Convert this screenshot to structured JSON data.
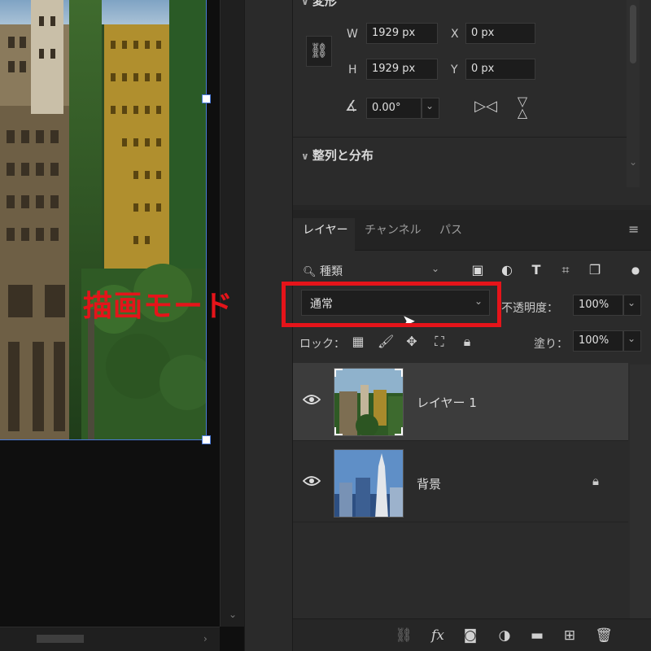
{
  "properties": {
    "section_transform": "変形",
    "w_label": "W",
    "w_value": "1929 px",
    "h_label": "H",
    "h_value": "1929 px",
    "x_label": "X",
    "x_value": "0 px",
    "y_label": "Y",
    "y_value": "0 px",
    "angle_value": "0.00°",
    "section_align": "整列と分布",
    "icons": [
      "link-icon",
      "angle-icon",
      "flip-horizontal-icon",
      "flip-vertical-icon",
      "chevron-down-icon"
    ]
  },
  "layers_panel": {
    "tabs": [
      {
        "label": "レイヤー",
        "active": true
      },
      {
        "label": "チャンネル",
        "active": false
      },
      {
        "label": "パス",
        "active": false
      }
    ],
    "filter_label": "種類",
    "filter_icons": [
      "image-filter-icon",
      "adjustment-filter-icon",
      "type-filter-icon",
      "shape-filter-icon",
      "smart-object-filter-icon",
      "filter-toggle-icon"
    ],
    "blend_mode": "通常",
    "opacity_label": "不透明度：",
    "opacity_value": "100%",
    "lock_label": "ロック：",
    "fill_label": "塗り：",
    "fill_value": "100%",
    "lock_icons": [
      "lock-transparency-icon",
      "lock-pixels-icon",
      "lock-position-icon",
      "lock-artboard-icon",
      "lock-all-icon"
    ],
    "layers": [
      {
        "name": "レイヤー 1",
        "visible": true,
        "selected": true,
        "locked": false
      },
      {
        "name": "背景",
        "visible": true,
        "selected": false,
        "locked": true
      }
    ],
    "footer_icons": [
      "link-layers-icon",
      "fx-icon",
      "mask-icon",
      "adjustment-layer-icon",
      "group-folder-icon",
      "new-layer-icon",
      "trash-icon"
    ],
    "fx_label": "fx"
  },
  "annotation": {
    "label": "描画モード",
    "color": "#e5141a"
  },
  "colors": {
    "panel_bg": "#2b2b2b",
    "selection_bg": "#3c3c3c",
    "highlight_red": "#e5141a",
    "bbox_blue": "#4a7bd8"
  }
}
